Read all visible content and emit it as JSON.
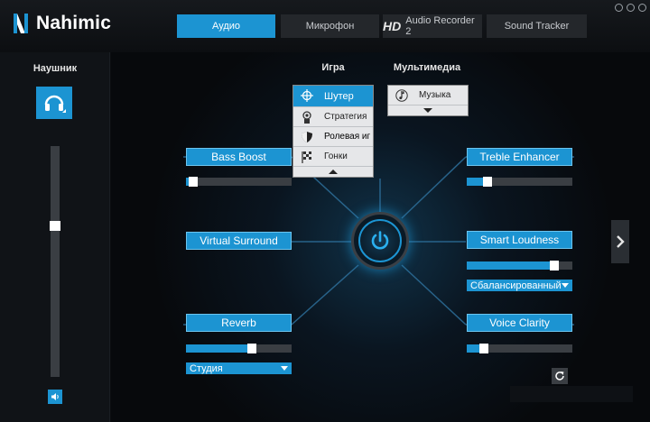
{
  "app": {
    "logo_text": "Nahimic"
  },
  "tabs": [
    {
      "label": "Аудио",
      "active": true
    },
    {
      "label": "Микрофон",
      "active": false
    },
    {
      "prefix": "HD",
      "label": "Audio Recorder 2",
      "active": false
    },
    {
      "label": "Sound Tracker",
      "active": false
    }
  ],
  "sidebar": {
    "title": "Наушник",
    "device_icon": "headphones-icon",
    "volume_level": 0.66,
    "mute_icon": "speaker-icon"
  },
  "presets": {
    "game": {
      "label": "Игра",
      "items": [
        {
          "label": "Шутер",
          "icon": "crosshair-icon",
          "selected": true
        },
        {
          "label": "Стратегия",
          "icon": "medal-icon",
          "selected": false
        },
        {
          "label": "Ролевая иг",
          "icon": "shield-icon",
          "selected": false
        },
        {
          "label": "Гонки",
          "icon": "checkered-flag-icon",
          "selected": false
        }
      ]
    },
    "multimedia": {
      "label": "Мультимедиа",
      "selected": {
        "label": "Музыка",
        "icon": "music-note-icon"
      }
    }
  },
  "effects": {
    "bass_boost": {
      "label": "Bass Boost",
      "level": 0.03
    },
    "virtual_surround": {
      "label": "Virtual Surround"
    },
    "reverb": {
      "label": "Reverb",
      "level": 0.64,
      "mode": "Студия"
    },
    "treble_enhancer": {
      "label": "Treble Enhancer",
      "level": 0.17
    },
    "smart_loudness": {
      "label": "Smart Loudness",
      "level": 0.86,
      "mode": "Сбалансированный"
    },
    "voice_clarity": {
      "label": "Voice Clarity",
      "level": 0.13
    }
  },
  "colors": {
    "accent": "#1c94d2",
    "track": "#3a3e43",
    "background": "#07090c"
  }
}
